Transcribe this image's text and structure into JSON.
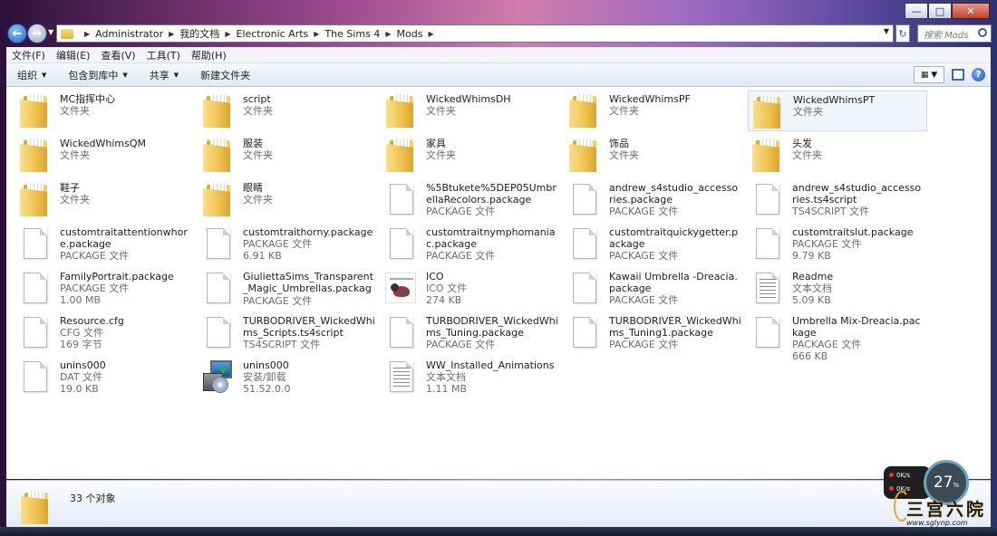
{
  "address_bar": {
    "breadcrumbs": [
      "Administrator",
      "我的文档",
      "Electronic Arts",
      "The Sims 4",
      "Mods"
    ],
    "search_placeholder": "搜索 Mods"
  },
  "menu_bar": [
    "文件(F)",
    "编辑(E)",
    "查看(V)",
    "工具(T)",
    "帮助(H)"
  ],
  "command_bar": {
    "organize": "组织",
    "include_in_library": "包含到库中",
    "share": "共享",
    "new_folder": "新建文件夹"
  },
  "files": [
    {
      "name": "MC指挥中心",
      "type": "文件夹",
      "size": "",
      "icon": "folder-icon"
    },
    {
      "name": "script",
      "type": "文件夹",
      "size": "",
      "icon": "folder-icon"
    },
    {
      "name": "WickedWhimsDH",
      "type": "文件夹",
      "size": "",
      "icon": "folder-icon"
    },
    {
      "name": "WickedWhimsPF",
      "type": "文件夹",
      "size": "",
      "icon": "folder-icon"
    },
    {
      "name": "WickedWhimsPT",
      "type": "文件夹",
      "size": "",
      "icon": "folder-icon",
      "selected": true
    },
    {
      "name": "WickedWhimsQM",
      "type": "文件夹",
      "size": "",
      "icon": "folder-icon"
    },
    {
      "name": "服装",
      "type": "文件夹",
      "size": "",
      "icon": "folder-icon"
    },
    {
      "name": "家具",
      "type": "文件夹",
      "size": "",
      "icon": "folder-icon"
    },
    {
      "name": "饰品",
      "type": "文件夹",
      "size": "",
      "icon": "folder-icon"
    },
    {
      "name": "头发",
      "type": "文件夹",
      "size": "",
      "icon": "folder-icon"
    },
    {
      "name": "鞋子",
      "type": "文件夹",
      "size": "",
      "icon": "folder-icon"
    },
    {
      "name": "眼睛",
      "type": "文件夹",
      "size": "",
      "icon": "folder-icon"
    },
    {
      "name": "%5Btukete%5DEP05UmbrellaRecolors.package",
      "type": "PACKAGE 文件",
      "size": "",
      "icon": "document-icon"
    },
    {
      "name": "andrew_s4studio_accessories.package",
      "type": "PACKAGE 文件",
      "size": "",
      "icon": "document-icon"
    },
    {
      "name": "andrew_s4studio_accessories.ts4script",
      "type": "TS4SCRIPT 文件",
      "size": "",
      "icon": "document-icon"
    },
    {
      "name": "customtraitattentionwhore.package",
      "type": "PACKAGE 文件",
      "size": "",
      "icon": "document-icon"
    },
    {
      "name": "customtraithorny.package",
      "type": "PACKAGE 文件",
      "size": "6.91 KB",
      "icon": "document-icon"
    },
    {
      "name": "customtraitnymphomaniac.package",
      "type": "PACKAGE 文件",
      "size": "",
      "icon": "document-icon"
    },
    {
      "name": "customtraitquickygetter.package",
      "type": "PACKAGE 文件",
      "size": "",
      "icon": "document-icon"
    },
    {
      "name": "customtraitslut.package",
      "type": "PACKAGE 文件",
      "size": "9.79 KB",
      "icon": "document-icon"
    },
    {
      "name": "FamilyPortrait.package",
      "type": "PACKAGE 文件",
      "size": "1.00 MB",
      "icon": "document-icon"
    },
    {
      "name": "GiuliettaSims_Transparent_Magic_Umbrellas.package",
      "type": "PACKAGE 文件",
      "size": "",
      "icon": "document-icon"
    },
    {
      "name": "ICO",
      "type": "ICO 文件",
      "size": "274 KB",
      "icon": "image-icon"
    },
    {
      "name": "Kawaii Umbrella -Dreacia.package",
      "type": "PACKAGE 文件",
      "size": "",
      "icon": "document-icon"
    },
    {
      "name": "Readme",
      "type": "文本文档",
      "size": "5.09 KB",
      "icon": "text-document-icon"
    },
    {
      "name": "Resource.cfg",
      "type": "CFG 文件",
      "size": "169 字节",
      "icon": "document-icon"
    },
    {
      "name": "TURBODRIVER_WickedWhims_Scripts.ts4script",
      "type": "TS4SCRIPT 文件",
      "size": "",
      "icon": "document-icon"
    },
    {
      "name": "TURBODRIVER_WickedWhims_Tuning.package",
      "type": "PACKAGE 文件",
      "size": "",
      "icon": "document-icon"
    },
    {
      "name": "TURBODRIVER_WickedWhims_Tuning1.package",
      "type": "PACKAGE 文件",
      "size": "",
      "icon": "document-icon"
    },
    {
      "name": "Umbrella Mix-Dreacia.package",
      "type": "PACKAGE 文件",
      "size": "666 KB",
      "icon": "document-icon"
    },
    {
      "name": "unins000",
      "type": "DAT 文件",
      "size": "19.0 KB",
      "icon": "document-icon"
    },
    {
      "name": "unins000",
      "type": "安装/卸载",
      "size": "51.52.0.0",
      "icon": "installer-icon"
    },
    {
      "name": "WW_Installed_Animations",
      "type": "文本文档",
      "size": "1.11 MB",
      "icon": "text-document-icon"
    }
  ],
  "status_bar": {
    "item_count": "33 个对象"
  },
  "overlay": {
    "net_up": "0K/s",
    "net_down": "0K/s",
    "cpu_value": "27",
    "cpu_unit": "%",
    "watermark_cn": "三宫六院",
    "watermark_url": "www.sglynp.com"
  }
}
